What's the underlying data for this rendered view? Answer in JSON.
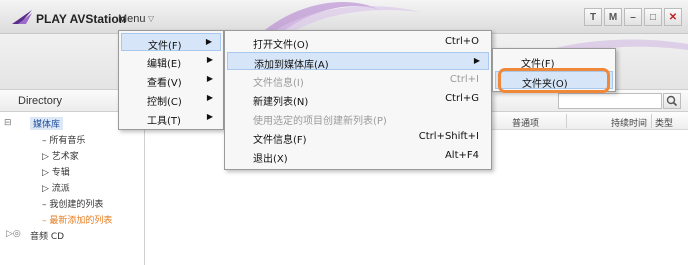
{
  "app": {
    "title": "PLAY AVStation",
    "menu_label": "Menu"
  },
  "window_buttons": [
    "T",
    "M",
    "–",
    "□",
    "✕"
  ],
  "directory_label": "Directory",
  "sidebar": {
    "items": [
      {
        "label": "媒体库",
        "style": "selected"
      },
      {
        "label": "所有音乐"
      },
      {
        "label": "艺术家"
      },
      {
        "label": "专辑"
      },
      {
        "label": "流派"
      },
      {
        "label": "我创建的列表"
      },
      {
        "label": "最新添加的列表",
        "color": "#e67e22"
      },
      {
        "label": "音频 CD"
      }
    ]
  },
  "list_columns": [
    "普通项",
    "持续时间",
    "类型"
  ],
  "main_menu": {
    "items": [
      {
        "label": "文件(F)"
      },
      {
        "label": "编辑(E)"
      },
      {
        "label": "查看(V)"
      },
      {
        "label": "控制(C)"
      },
      {
        "label": "工具(T)"
      }
    ]
  },
  "file_menu": {
    "items": [
      {
        "label": "打开文件(O)",
        "shortcut": "Ctrl+O"
      },
      {
        "label": "添加到媒体库(A)",
        "submenu": true
      },
      {
        "label": "文件信息(I)",
        "shortcut": "Ctrl+I",
        "disabled": true
      },
      {
        "label": "新建列表(N)",
        "shortcut": "Ctrl+G"
      },
      {
        "label": "使用选定的项目创建新列表(P)",
        "disabled": true
      },
      {
        "label": "文件信息(F)",
        "shortcut": "Ctrl+Shift+I"
      },
      {
        "label": "退出(X)",
        "shortcut": "Alt+F4"
      }
    ]
  },
  "add_submenu": {
    "items": [
      {
        "label": "文件(F)"
      },
      {
        "label": "文件夹(O)"
      }
    ]
  },
  "colors": {
    "highlight_ring": "#f0883a",
    "menu_highlight": "#d6e6f8",
    "selected_tree": "#1f4e9a"
  }
}
